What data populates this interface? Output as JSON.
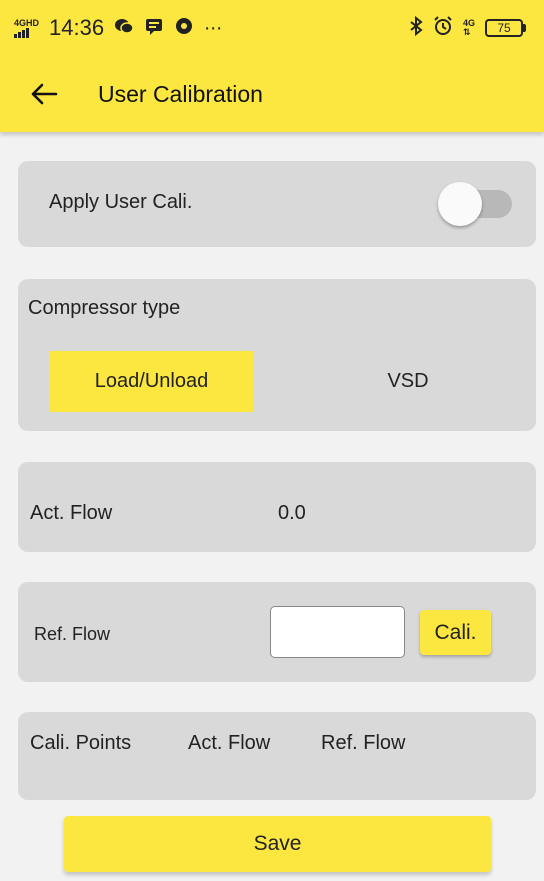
{
  "status_bar": {
    "network_label": "4GHD",
    "time": "14:36",
    "right_network": "4G",
    "battery": "75"
  },
  "app_bar": {
    "title": "User Calibration"
  },
  "apply_card": {
    "label": "Apply User Cali.",
    "toggle_on": false
  },
  "compressor_card": {
    "label": "Compressor type",
    "options": [
      "Load/Unload",
      "VSD"
    ],
    "selected": "Load/Unload"
  },
  "act_flow_card": {
    "label": "Act. Flow",
    "value": "0.0"
  },
  "ref_flow_card": {
    "label": "Ref. Flow",
    "input_value": "",
    "button_label": "Cali."
  },
  "cali_points_card": {
    "headers": [
      "Cali. Points",
      "Act. Flow",
      "Ref. Flow"
    ]
  },
  "save_label": "Save",
  "colors": {
    "accent": "#fce640",
    "card": "#d9d9d9",
    "background": "#f2f2f2"
  }
}
